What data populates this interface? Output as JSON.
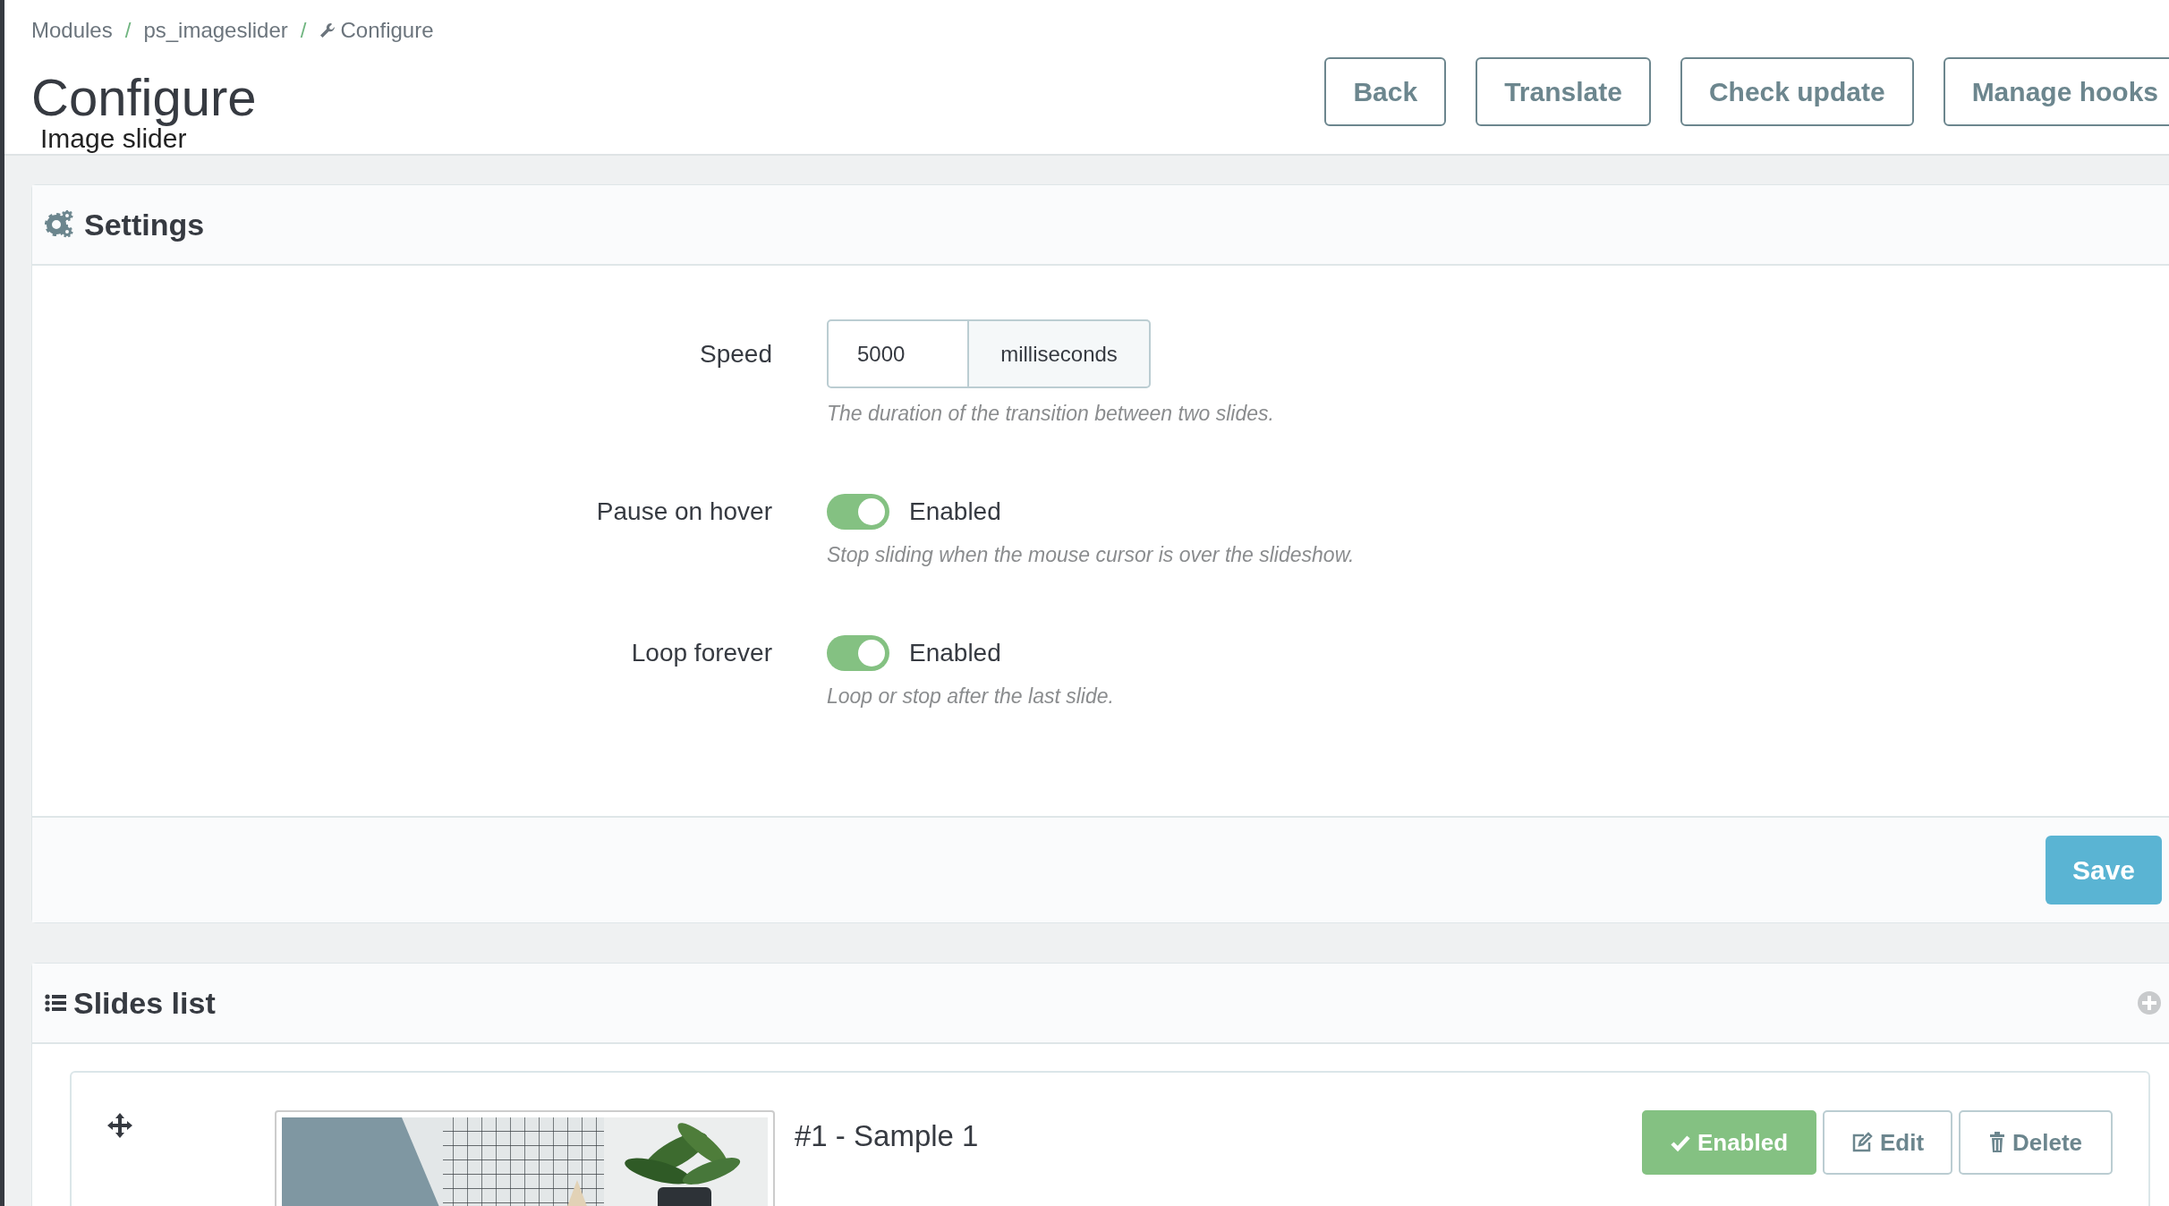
{
  "breadcrumb": [
    {
      "kind": "link",
      "label": "Modules"
    },
    {
      "kind": "separator",
      "label": "/"
    },
    {
      "kind": "link",
      "label": "ps_imageslider"
    },
    {
      "kind": "separator",
      "label": "/"
    },
    {
      "kind": "current",
      "label": "Configure"
    }
  ],
  "page": {
    "title": "Configure",
    "subtitle": "Image slider"
  },
  "toolbar_buttons": [
    "Back",
    "Translate",
    "Check update",
    "Manage hooks"
  ],
  "settings": {
    "title": "Settings",
    "fields": [
      {
        "kind": "input",
        "label": "Speed",
        "value": "5000",
        "addon": "milliseconds",
        "hint": "The duration of the transition between two slides."
      },
      {
        "kind": "switch",
        "label": "Pause on hover",
        "on": true,
        "state_label": "Enabled",
        "hint": "Stop sliding when the mouse cursor is over the slideshow."
      },
      {
        "kind": "switch",
        "label": "Loop forever",
        "on": true,
        "state_label": "Enabled",
        "hint": "Loop or stop after the last slide."
      }
    ],
    "save_button": "Save"
  },
  "slides_panel": {
    "title": "Slides list",
    "slides": [
      {
        "title": "#1 - Sample 1",
        "enabled": true,
        "status_label": "Enabled",
        "edit_label": "Edit",
        "delete_label": "Delete"
      }
    ]
  }
}
